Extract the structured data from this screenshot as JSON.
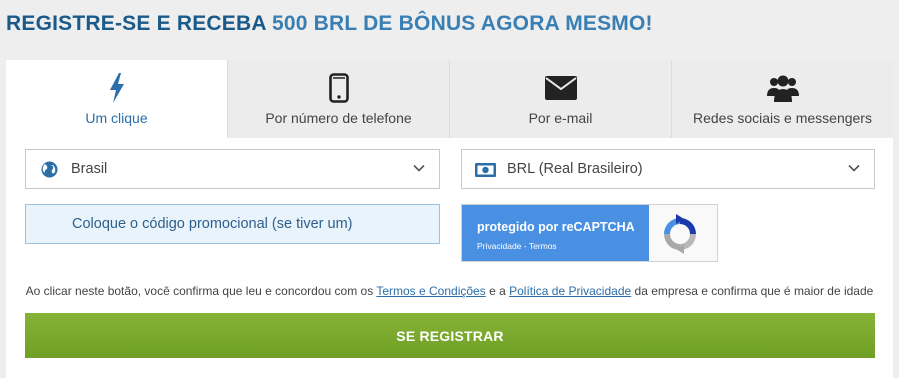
{
  "header": {
    "title_part1": "REGISTRE-SE E RECEBA",
    "title_part2": "500 BRL DE BÔNUS AGORA MESMO!"
  },
  "tabs": [
    {
      "label": "Um clique",
      "icon": "lightning-icon",
      "active": true
    },
    {
      "label": "Por número de telefone",
      "icon": "phone-icon",
      "active": false
    },
    {
      "label": "Por e-mail",
      "icon": "envelope-icon",
      "active": false
    },
    {
      "label": "Redes sociais e messengers",
      "icon": "users-icon",
      "active": false
    }
  ],
  "form": {
    "country": {
      "value": "Brasil",
      "icon": "globe-icon"
    },
    "currency": {
      "value": "BRL (Real Brasileiro)",
      "icon": "banknote-icon"
    },
    "promo": {
      "label": "Coloque o código promocional (se tiver um)"
    },
    "captcha": {
      "title": "protegido por reCAPTCHA",
      "links": "Privacidade - Termos"
    },
    "consent": {
      "text1": "Ao clicar neste botão, você confirma que leu e concordou com os",
      "link1": "Termos e Condições",
      "text2": "e a",
      "link2": "Política de Privacidade",
      "text3": "da empresa e confirma que é maior de idade"
    },
    "submit_label": "SE REGISTRAR"
  },
  "colors": {
    "title_dark": "#1a5a8a",
    "title_accent": "#3a7fb4",
    "active_tab_text": "#2b6ea8",
    "button_green": "#7aaa2e",
    "promo_bg": "#e9f3fc",
    "captcha_blue": "#4a90e2"
  }
}
